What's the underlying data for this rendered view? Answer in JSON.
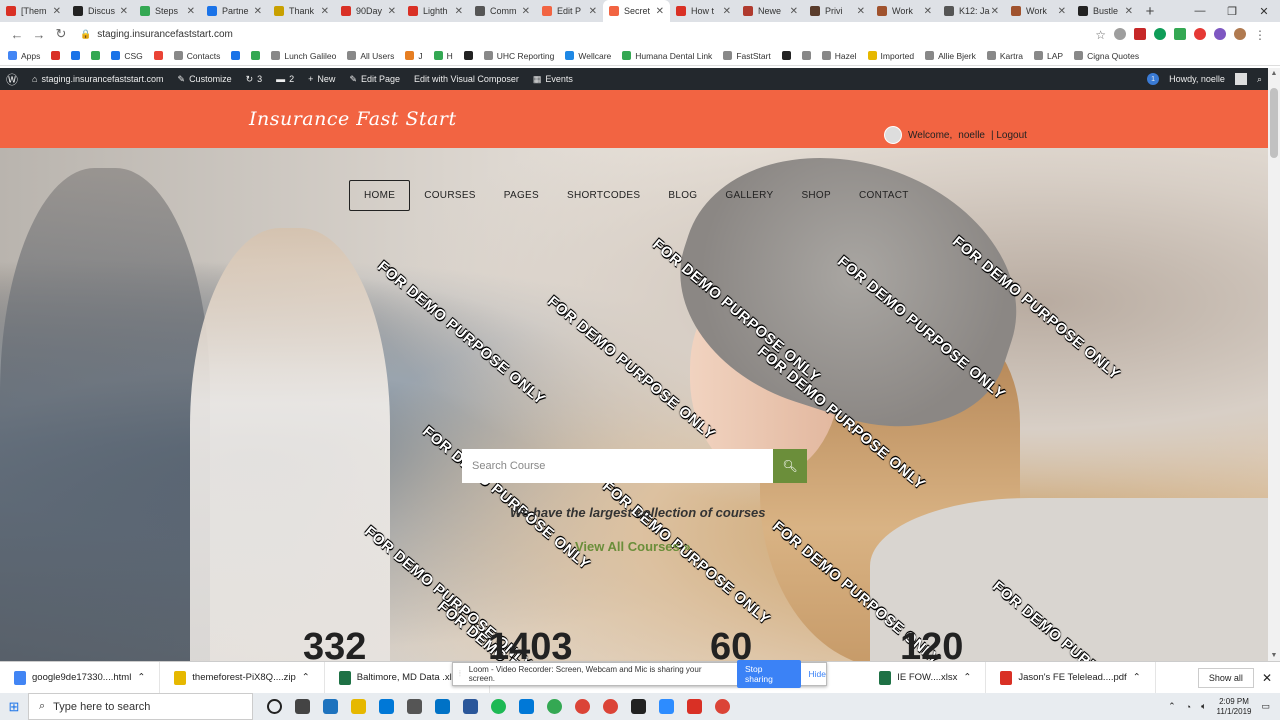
{
  "browser": {
    "tabs": [
      {
        "title": "[Them",
        "color": "#d93025"
      },
      {
        "title": "Discus",
        "color": "#222222"
      },
      {
        "title": "Steps",
        "color": "#34a853"
      },
      {
        "title": "Partne",
        "color": "#1a73e8"
      },
      {
        "title": "Thank",
        "color": "#c8a000"
      },
      {
        "title": "90Day",
        "color": "#d93025"
      },
      {
        "title": "Lighth",
        "color": "#d93025"
      },
      {
        "title": "Comm",
        "color": "#555555"
      },
      {
        "title": "Edit P",
        "color": "#f26442"
      },
      {
        "title": "Secret",
        "color": "#f26442",
        "active": true
      },
      {
        "title": "How t",
        "color": "#d93025"
      },
      {
        "title": "Newe",
        "color": "#b03a2e"
      },
      {
        "title": "Privi",
        "color": "#5a3c2c"
      },
      {
        "title": "Work",
        "color": "#a0522d"
      },
      {
        "title": "K12: Ja",
        "color": "#555555"
      },
      {
        "title": "Work",
        "color": "#a0522d"
      },
      {
        "title": "Bustle",
        "color": "#222222"
      }
    ],
    "url": "staging.insurancefaststart.com",
    "bookmarks": [
      "Apps",
      "",
      "",
      "",
      "CSG",
      "",
      "Contacts",
      "",
      "",
      "Lunch Galileo",
      "All Users",
      "J",
      "H",
      "",
      "UHC Reporting",
      "Wellcare",
      "Humana Dental Link",
      "FastStart",
      "",
      "",
      "Hazel",
      "Imported",
      "Allie Bjerk",
      "Kartra",
      "LAP",
      "Cigna Quotes"
    ]
  },
  "wp_admin": {
    "site": "staging.insurancefaststart.com",
    "customize": "Customize",
    "updates": "3",
    "comments": "2",
    "new": "New",
    "edit_page": "Edit Page",
    "visual_composer": "Edit with Visual Composer",
    "events": "Events",
    "howdy": "Howdy, noelle",
    "notif": "1"
  },
  "site": {
    "logo": "Insurance Fast Start",
    "welcome": "Welcome,",
    "user": "noelle",
    "logout": "| Logout",
    "menu": [
      "HOME",
      "COURSES",
      "PAGES",
      "SHORTCODES",
      "BLOG",
      "GALLERY",
      "SHOP",
      "CONTACT"
    ],
    "search_placeholder": "Search Course",
    "tagline": "We have the largest collection of courses",
    "view_all": "View All Courses »",
    "watermark": "FOR DEMO PURPOSE ONLY",
    "stats": [
      "332",
      "1403",
      "60",
      "120"
    ]
  },
  "downloads": {
    "items": [
      {
        "name": "google9de17330....html",
        "color": "#4285f4"
      },
      {
        "name": "themeforest-PiX8Q....zip",
        "color": "#e6b800"
      },
      {
        "name": "Baltimore, MD Data .xlsx",
        "color": "#1e7145"
      },
      {
        "name": "IE FOW....xlsx",
        "color": "#1e7145"
      },
      {
        "name": "Jason's FE Telelead....pdf",
        "color": "#d93025"
      }
    ],
    "show_all": "Show all"
  },
  "loom": {
    "message": "Loom - Video Recorder: Screen, Webcam and Mic is sharing your screen.",
    "stop": "Stop sharing",
    "hide": "Hide"
  },
  "taskbar": {
    "search_placeholder": "Type here to search",
    "time": "2:09 PM",
    "date": "11/1/2019"
  }
}
